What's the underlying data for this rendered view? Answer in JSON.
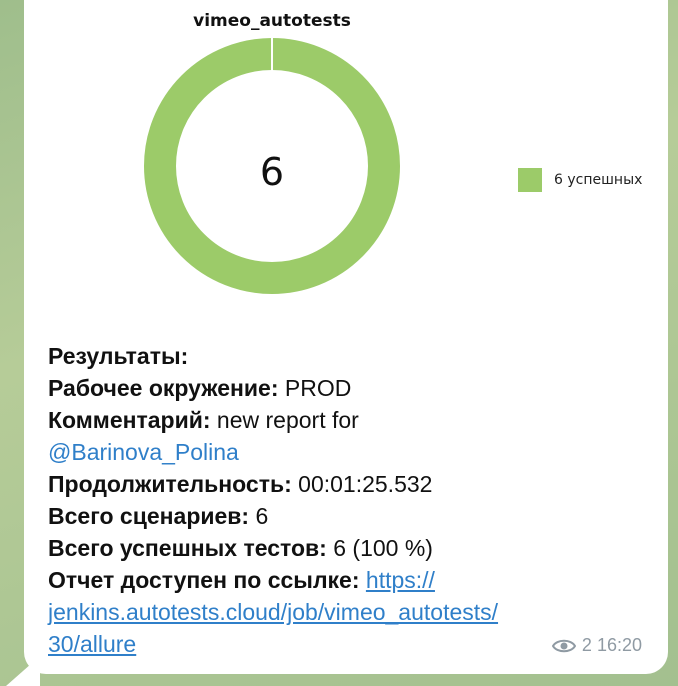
{
  "chart": {
    "title": "vimeo_autotests",
    "center_value": "6",
    "legend_label": "6 успешных",
    "color": "#9ccb69"
  },
  "chart_data": {
    "type": "pie",
    "title": "vimeo_autotests",
    "categories": [
      "6 успешных"
    ],
    "values": [
      6
    ],
    "colors": [
      "#9ccb69"
    ],
    "legend_position": "right"
  },
  "report": {
    "results_label": "Результаты:",
    "env_label": "Рабочее окружение:",
    "env_value": " PROD",
    "comment_label": "Комментарий:",
    "comment_value": " new report for",
    "mention": "@Barinova_Polina",
    "duration_label": "Продолжительность:",
    "duration_value": " 00:01:25.532",
    "scenarios_label": "Всего сценариев:",
    "scenarios_value": " 6",
    "passed_label": "Всего успешных тестов:",
    "passed_value": " 6 (100 %)",
    "link_label": "Отчет доступен по ссылке:",
    "link_part1": "https://",
    "link_part2": "jenkins.autotests.cloud/job/vimeo_autotests/",
    "link_part3": "30/allure"
  },
  "meta": {
    "views": "2",
    "time": "16:20"
  }
}
